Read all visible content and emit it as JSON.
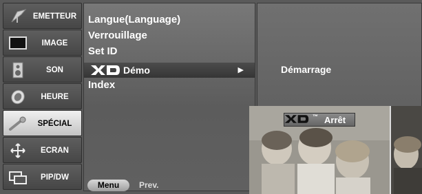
{
  "sidebar": {
    "items": [
      {
        "label": "EMETTEUR",
        "icon": "antenna-icon",
        "active": false
      },
      {
        "label": "IMAGE",
        "icon": "monitor-icon",
        "active": false
      },
      {
        "label": "SON",
        "icon": "speaker-icon",
        "active": false
      },
      {
        "label": "HEURE",
        "icon": "clock-icon",
        "active": false
      },
      {
        "label": "SPÉCIAL",
        "icon": "key-icon",
        "active": true
      },
      {
        "label": "ECRAN",
        "icon": "move-arrows-icon",
        "active": false
      },
      {
        "label": "PIP/DW",
        "icon": "pip-windows-icon",
        "active": false
      }
    ]
  },
  "menu": {
    "items": [
      {
        "label": "Langue(Language)"
      },
      {
        "label": "Verrouillage"
      },
      {
        "label": "Set ID"
      },
      {
        "label": "Démo",
        "logo": "XD",
        "selected": true,
        "has_submenu": true
      },
      {
        "label": "Index"
      }
    ],
    "menu_button": "Menu",
    "prev_label": "Prev."
  },
  "submenu": {
    "label": "Démarrage"
  },
  "preview": {
    "logo": "XD",
    "trademark": "™",
    "label": "Arrêt"
  },
  "colors": {
    "active_tab": "#dcdcdc",
    "panel": "#6a6a6a",
    "highlight": "#404040",
    "text": "#ffffff"
  }
}
